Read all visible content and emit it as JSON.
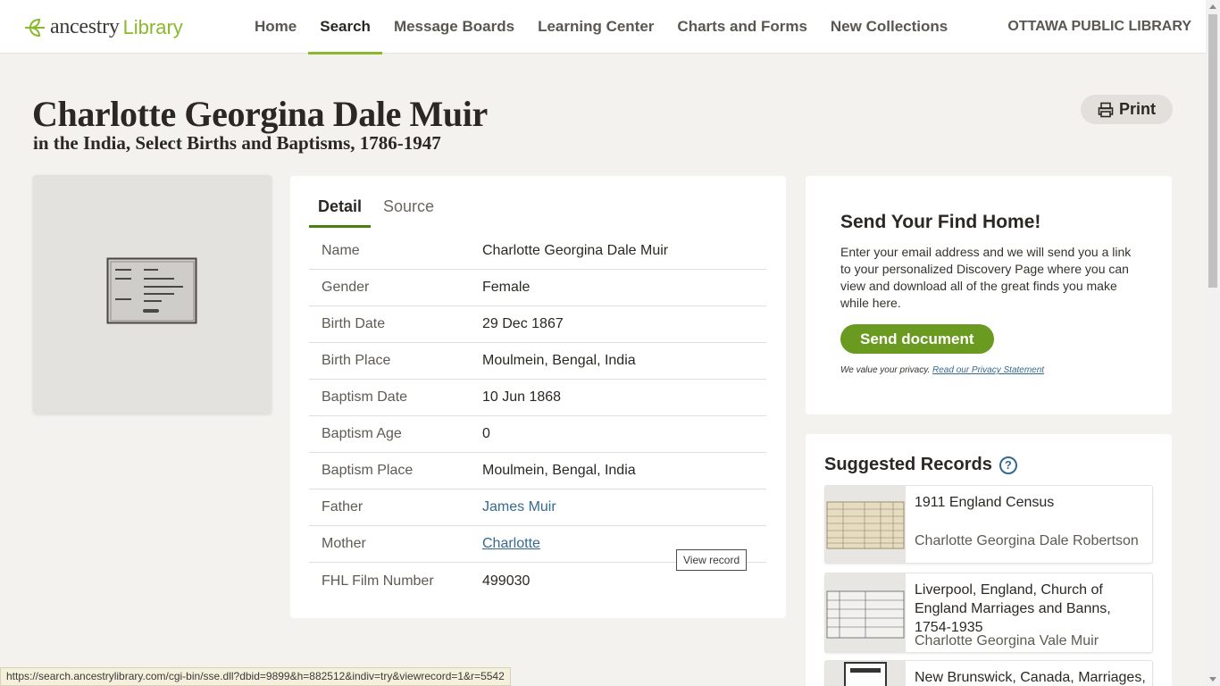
{
  "header": {
    "brand": "ancestry",
    "brand_suffix": "Library",
    "nav": [
      "Home",
      "Search",
      "Message Boards",
      "Learning Center",
      "Charts and Forms",
      "New Collections"
    ],
    "active_nav": "Search",
    "library_name": "OTTAWA PUBLIC LIBRARY"
  },
  "record": {
    "title": "Charlotte Georgina Dale Muir",
    "subtitle": "in the India, Select Births and Baptisms, 1786-1947",
    "print_label": "Print"
  },
  "tabs": {
    "detail": "Detail",
    "source": "Source"
  },
  "details": [
    {
      "label": "Name",
      "value": "Charlotte Georgina Dale Muir"
    },
    {
      "label": "Gender",
      "value": "Female"
    },
    {
      "label": "Birth Date",
      "value": "29 Dec 1867"
    },
    {
      "label": "Birth Place",
      "value": "Moulmein, Bengal, India"
    },
    {
      "label": "Baptism Date",
      "value": "10 Jun 1868"
    },
    {
      "label": "Baptism Age",
      "value": "0"
    },
    {
      "label": "Baptism Place",
      "value": "Moulmein, Bengal, India"
    },
    {
      "label": "Father",
      "value": "James Muir"
    },
    {
      "label": "Mother",
      "value": "Charlotte"
    },
    {
      "label": "FHL Film Number",
      "value": "499030"
    }
  ],
  "view_record_tooltip": "View record",
  "send_home": {
    "title": "Send Your Find Home!",
    "description": "Enter your email address and we will send you a link to your personalized Discovery Page where you can view and download all of the great finds you make while here.",
    "button": "Send document",
    "privacy_prefix": "We value your privacy.",
    "privacy_link": "Read our Privacy Statement"
  },
  "suggested": {
    "title": "Suggested Records",
    "records": [
      {
        "title": "1911 England Census",
        "name": "Charlotte Georgina Dale Robertson"
      },
      {
        "title": "Liverpool, England, Church of England Marriages and Banns, 1754-1935",
        "name": "Charlotte Georgina Vale Muir"
      },
      {
        "title": "New Brunswick, Canada, Marriages,",
        "name": ""
      }
    ]
  },
  "status_url": "https://search.ancestrylibrary.com/cgi-bin/sse.dll?dbid=9899&h=882512&indiv=try&viewrecord=1&r=5542",
  "colors": {
    "accent_green": "#8cb82d",
    "button_green": "#6a9a1f",
    "link_blue": "#356a8f"
  }
}
